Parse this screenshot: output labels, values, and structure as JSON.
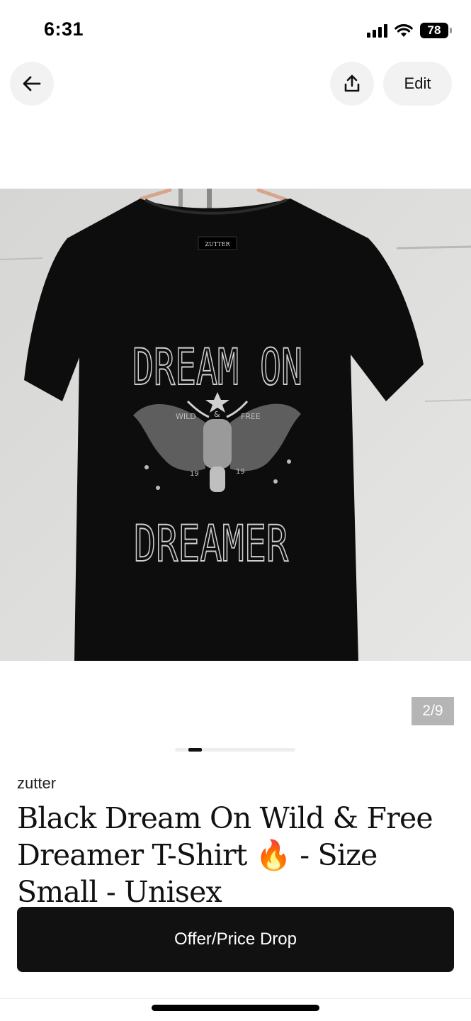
{
  "status_bar": {
    "time": "6:31",
    "battery": "78",
    "icons": [
      "cellular-signal-icon",
      "wifi-icon",
      "battery-icon"
    ]
  },
  "nav": {
    "back_icon": "arrow-left-icon",
    "share_icon": "share-upload-icon",
    "edit_label": "Edit"
  },
  "gallery": {
    "counter": "2/9",
    "current": 2,
    "total": 9
  },
  "listing": {
    "brand": "zutter",
    "title": "Black Dream On Wild & Free Dreamer T-Shirt 🔥 - Size Small - Unisex",
    "photo": {
      "shirt_tag": "ZUTTER",
      "print_top": "DREAM ON",
      "print_bottom": "DREAMER",
      "print_small_left": "WILD",
      "print_small_mid": "&",
      "print_small_right": "FREE",
      "print_year_left": "19",
      "print_year_right": "19"
    }
  },
  "actions": {
    "offer_label": "Offer/Price Drop"
  },
  "colors": {
    "button_bg": "#111111",
    "nav_button_bg": "#f2f2f2",
    "counter_bg": "#b5b5b5"
  }
}
